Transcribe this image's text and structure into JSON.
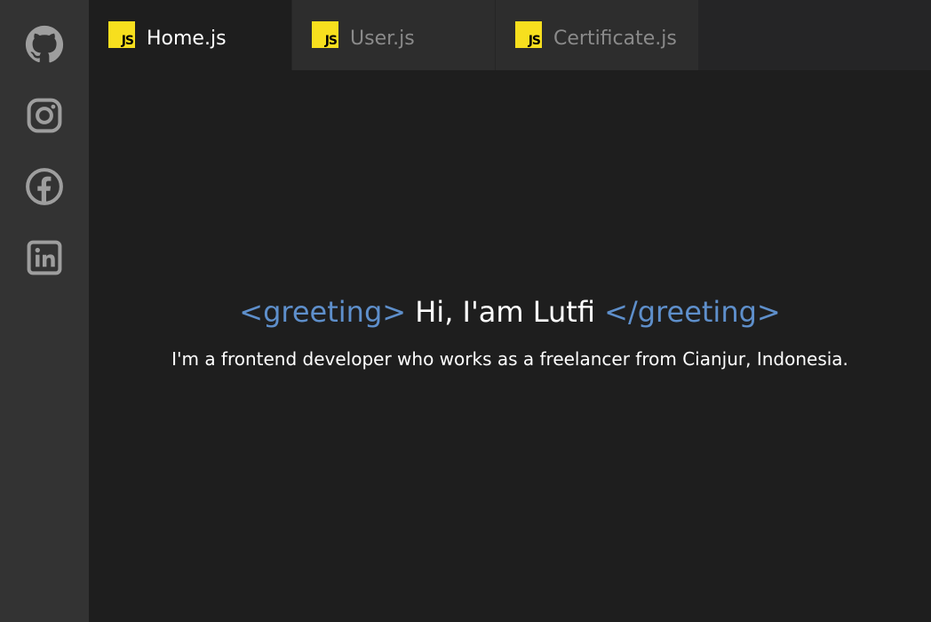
{
  "sidebar": {
    "icons": [
      "github-icon",
      "instagram-icon",
      "facebook-icon",
      "linkedin-icon"
    ],
    "icon_color": "#9e9e9e"
  },
  "tabs": [
    {
      "label": "Home.js",
      "badge": "JS",
      "active": true
    },
    {
      "label": "User.js",
      "badge": "JS",
      "active": false
    },
    {
      "label": "Certificate.js",
      "badge": "JS",
      "active": false
    }
  ],
  "main": {
    "greeting_open": "<greeting>",
    "greeting_text": "Hi, I'am Lutfi",
    "greeting_close": "</greeting>",
    "description": "I'm a frontend developer who works as a freelancer from Cianjur, Indonesia."
  },
  "colors": {
    "sidebar_bg": "#333333",
    "editor_bg": "#1e1e1e",
    "tab_bg": "#2d2d2d",
    "js_badge": "#f7df1e",
    "tag_color": "#5e8fcb",
    "text": "#ffffff",
    "inactive_tab_text": "#8a8a8a"
  }
}
